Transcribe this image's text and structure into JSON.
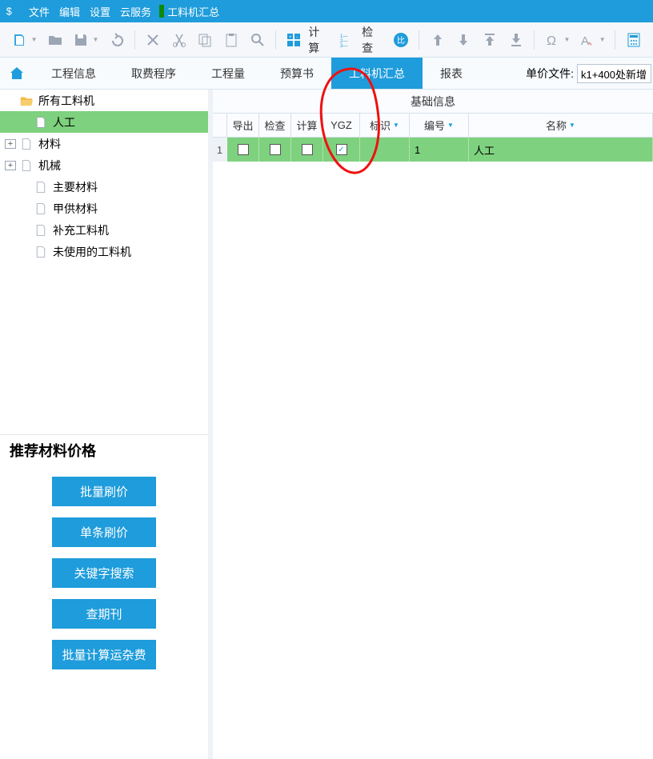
{
  "titlebar": {
    "menus": [
      "文件",
      "编辑",
      "设置",
      "云服务"
    ],
    "doc_title": "工料机汇总"
  },
  "toolbar": {
    "compute_label": "计算",
    "check_label": "检查"
  },
  "tabs": {
    "items": [
      "工程信息",
      "取费程序",
      "工程量",
      "预算书",
      "工料机汇总",
      "报表"
    ],
    "active_index": 4,
    "unit_file_label": "单价文件:",
    "unit_file_value": "k1+400处新增"
  },
  "tree": {
    "root": "所有工料机",
    "items": [
      {
        "label": "人工",
        "selected": true
      },
      {
        "label": "材料",
        "expandable": true
      },
      {
        "label": "机械",
        "expandable": true
      },
      {
        "label": "主要材料",
        "indent": true
      },
      {
        "label": "甲供材料",
        "indent": true
      },
      {
        "label": "补充工料机",
        "indent": true
      },
      {
        "label": "未使用的工料机",
        "indent": true
      }
    ]
  },
  "panel": {
    "title": "推荐材料价格",
    "buttons": [
      "批量刷价",
      "单条刷价",
      "关键字搜索",
      "查期刊",
      "批量计算运杂费"
    ]
  },
  "grid": {
    "group_header": "基础信息",
    "headers": {
      "export": "导出",
      "check": "检查",
      "calc": "计算",
      "ygz": "YGZ",
      "mark": "标识",
      "code": "编号",
      "name": "名称"
    },
    "row": {
      "num": "1",
      "export": false,
      "check": false,
      "calc": false,
      "ygz": true,
      "code": "1",
      "name": "人工"
    }
  }
}
